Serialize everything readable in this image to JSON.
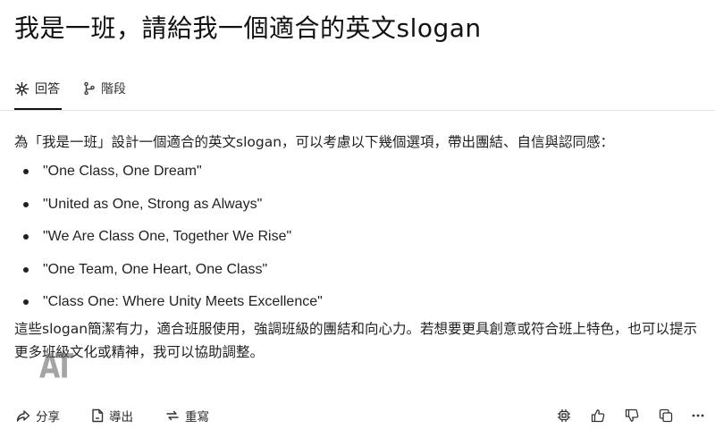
{
  "question": {
    "title": "我是一班，請給我一個適合的英文slogan"
  },
  "tabs": [
    {
      "label": "回答",
      "icon": "sparkle-icon",
      "active": true
    },
    {
      "label": "階段",
      "icon": "branch-icon",
      "active": false
    }
  ],
  "answer": {
    "intro": "為「我是一班」設計一個適合的英文slogan，可以考慮以下幾個選項，帶出團結、自信與認同感：",
    "slogans": [
      "\"One Class, One Dream\"",
      "\"United as One, Strong as Always\"",
      "\"We Are Class One, Together We Rise\"",
      "\"One Team, One Heart, One Class\"",
      "\"Class One: Where Unity Meets Excellence\""
    ],
    "closing": "這些slogan簡潔有力，適合班服使用，強調班級的團結和向心力。若想要更具創意或符合班上特色，也可以提示更多班級文化或精神，我可以協助調整。"
  },
  "actions": {
    "share": "分享",
    "export": "導出",
    "rewrite": "重寫"
  },
  "colors": {
    "text": "#1f2120",
    "accent_line": "#111111",
    "divider": "#e6e6e4"
  }
}
